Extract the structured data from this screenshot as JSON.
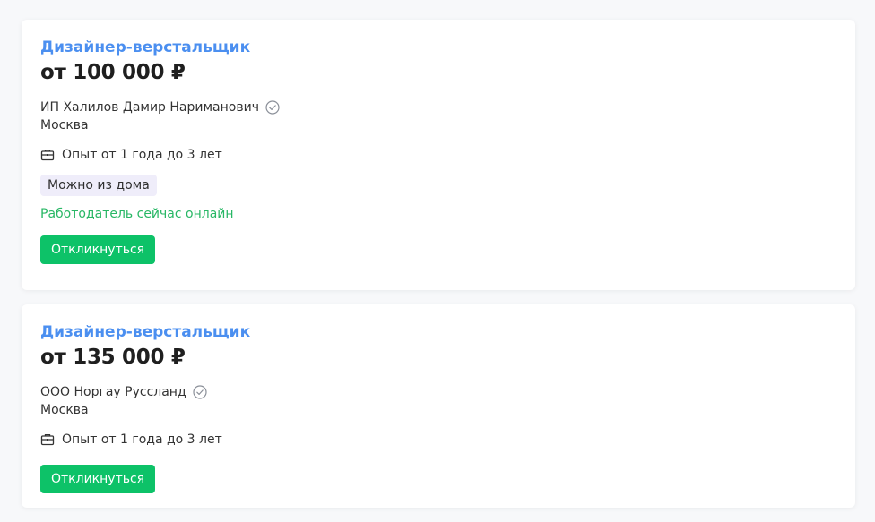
{
  "vacancies": [
    {
      "title": "Дизайнер-верстальщик",
      "salary": "от 100 000 ₽",
      "employer": "ИП Халилов Дамир Нариманович",
      "employer_verified_icon": "check-circle-icon",
      "city": "Москва",
      "experience_icon": "briefcase-icon",
      "experience": "Опыт от 1 года до 3 лет",
      "tag": "Можно из дома",
      "online_status": "Работодатель сейчас онлайн",
      "respond_label": "Откликнуться"
    },
    {
      "title": "Дизайнер-верстальщик",
      "salary": "от 135 000 ₽",
      "employer": "ООО Норгау Руссланд",
      "employer_verified_icon": "check-circle-icon",
      "city": "Москва",
      "experience_icon": "briefcase-icon",
      "experience": "Опыт от 1 года до 3 лет",
      "respond_label": "Откликнуться"
    }
  ],
  "colors": {
    "title_link": "#4b8ff0",
    "online_text": "#28b765",
    "respond_button": "#0dc268",
    "tag_background": "#efedfa"
  }
}
